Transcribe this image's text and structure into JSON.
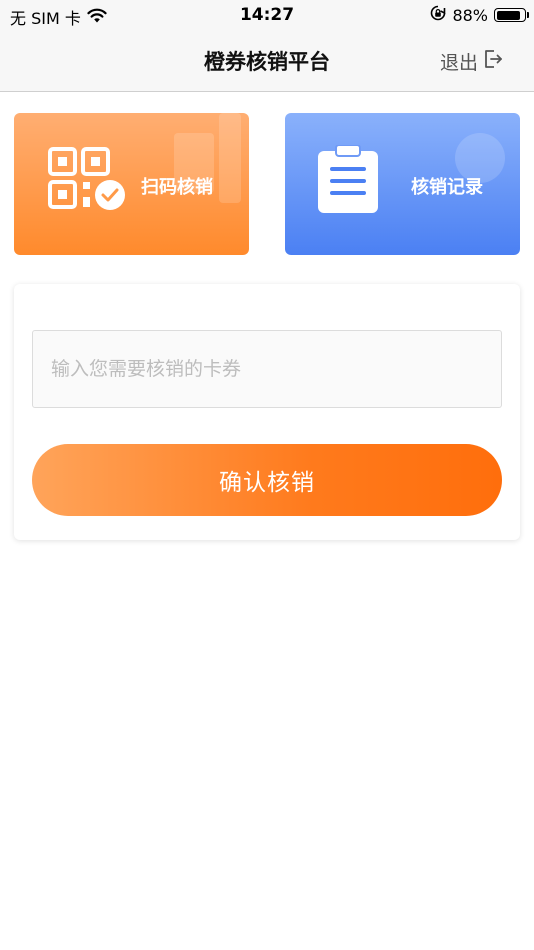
{
  "status_bar": {
    "carrier": "无 SIM 卡",
    "time": "14:27",
    "battery_text": "88%",
    "battery_level": 0.88
  },
  "nav": {
    "title": "橙券核销平台",
    "logout_label": "退出"
  },
  "actions": {
    "scan_label": "扫码核销",
    "records_label": "核销记录"
  },
  "form": {
    "code_placeholder": "输入您需要核销的卡券",
    "code_value": "",
    "confirm_label": "确认核销"
  },
  "colors": {
    "accent_orange": "#ff7a1c",
    "accent_blue": "#4b80f3"
  },
  "icons": {
    "wifi": "wifi-icon",
    "orientation_lock": "orientation-lock-icon",
    "battery": "battery-icon",
    "logout": "logout-icon",
    "qr_scan": "qr-code-check-icon",
    "records": "clipboard-list-icon"
  }
}
